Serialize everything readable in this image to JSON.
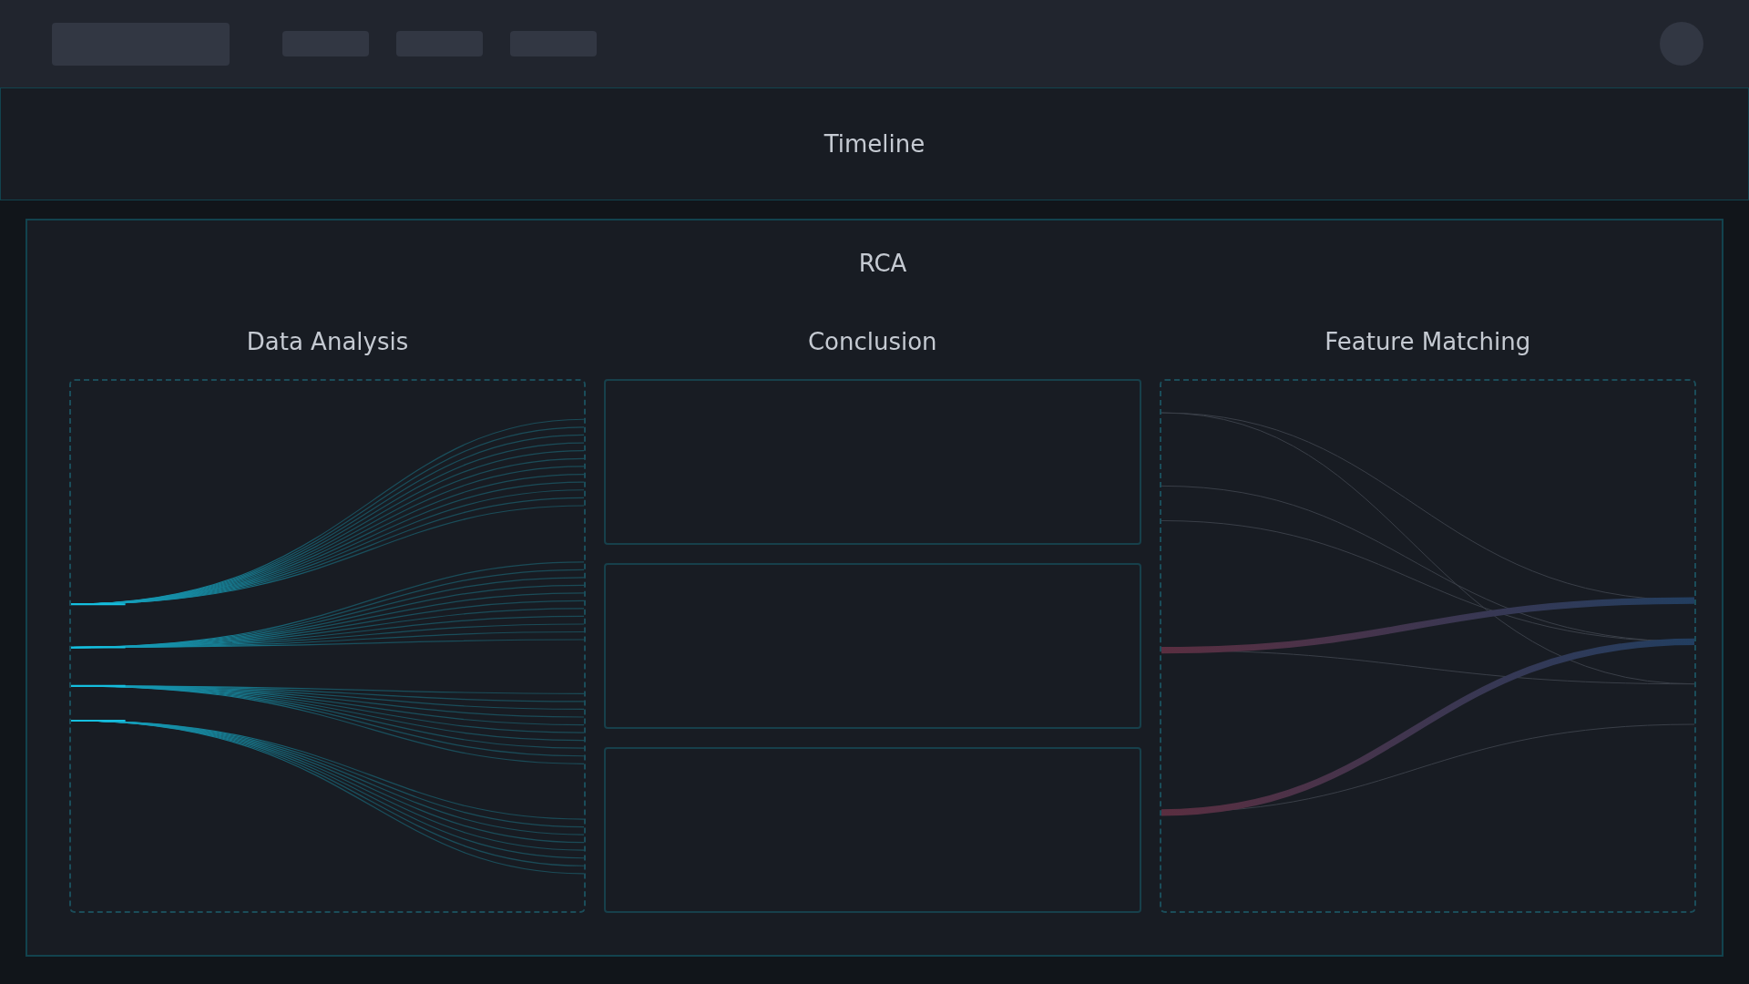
{
  "timeline": {
    "title": "Timeline"
  },
  "rca": {
    "title": "RCA",
    "columns": [
      {
        "title": "Data Analysis",
        "kind": "flows"
      },
      {
        "title": "Conclusion",
        "kind": "cards"
      },
      {
        "title": "Feature Matching",
        "kind": "matching"
      }
    ]
  }
}
